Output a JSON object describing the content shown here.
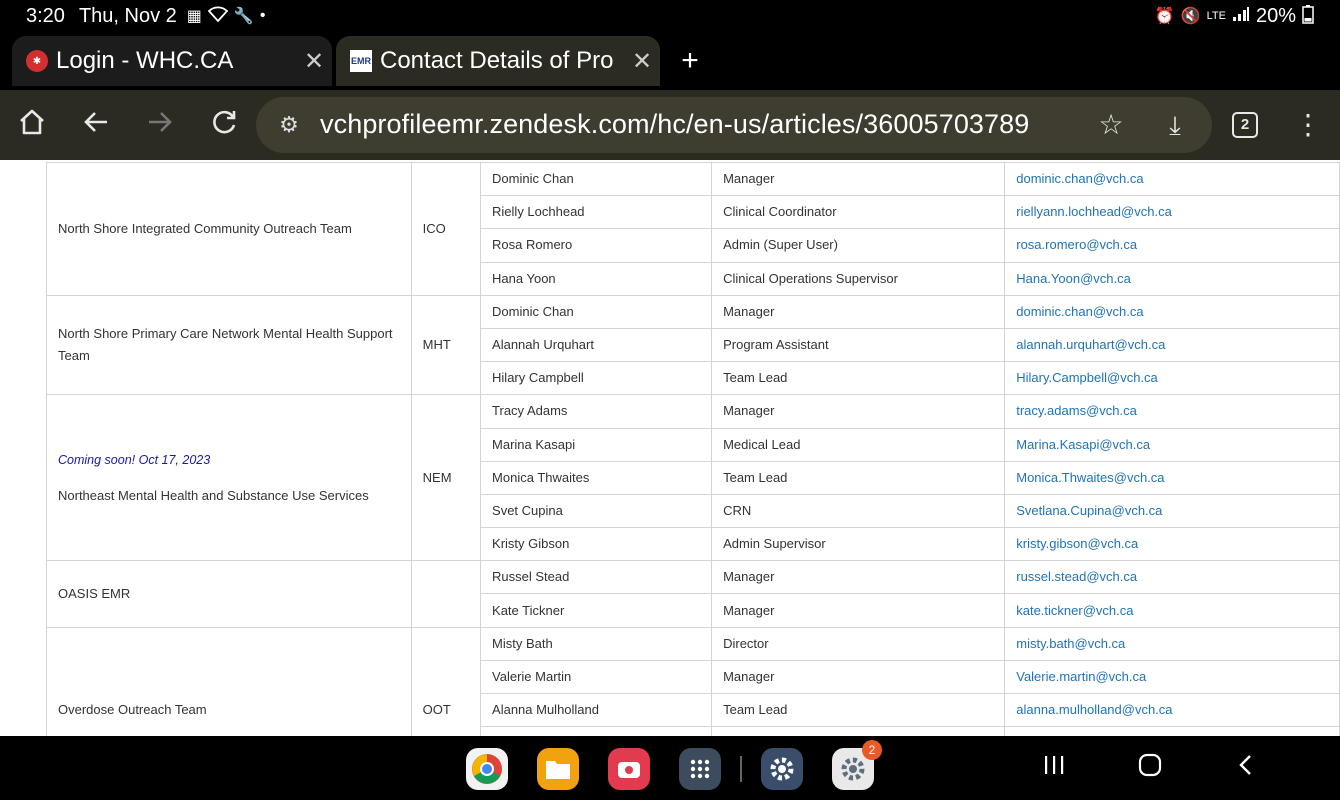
{
  "status_bar": {
    "time": "3:20",
    "date": "Thu, Nov 2",
    "network": "LTE",
    "battery": "20%"
  },
  "tabs": [
    {
      "title": "Login - WHC.CA",
      "favicon": "whc-logo-icon"
    },
    {
      "title": "Contact Details of Pro",
      "favicon": "emr-logo-icon"
    }
  ],
  "toolbar": {
    "url": "vchprofileemr.zendesk.com/hc/en-us/articles/36005703789",
    "tab_count": "2"
  },
  "table": {
    "groups": [
      {
        "team": "North Shore Integrated Community Outreach Team",
        "code": "ICO",
        "coming_soon": "",
        "contacts": [
          {
            "name": "Dominic Chan",
            "role": "Manager",
            "email": "dominic.chan@vch.ca"
          },
          {
            "name": "Rielly Lochhead",
            "role": "Clinical Coordinator",
            "email": "riellyann.lochhead@vch.ca"
          },
          {
            "name": "Rosa Romero",
            "role": "Admin (Super User)",
            "email": "rosa.romero@vch.ca"
          },
          {
            "name": "Hana Yoon",
            "role": "Clinical Operations Supervisor",
            "email": "Hana.Yoon@vch.ca"
          }
        ]
      },
      {
        "team": "North Shore Primary Care Network Mental Health Support Team",
        "code": "MHT",
        "coming_soon": "",
        "contacts": [
          {
            "name": "Dominic Chan",
            "role": "Manager",
            "email": "dominic.chan@vch.ca"
          },
          {
            "name": "Alannah Urquhart",
            "role": "Program Assistant",
            "email": "alannah.urquhart@vch.ca"
          },
          {
            "name": "Hilary Campbell",
            "role": "Team Lead",
            "email": "Hilary.Campbell@vch.ca"
          }
        ]
      },
      {
        "team": "Northeast Mental Health and Substance Use Services",
        "code": "NEM",
        "coming_soon": "Coming soon! Oct 17, 2023",
        "contacts": [
          {
            "name": "Tracy Adams",
            "role": "Manager",
            "email": "tracy.adams@vch.ca"
          },
          {
            "name": "Marina Kasapi",
            "role": "Medical Lead",
            "email": "Marina.Kasapi@vch.ca"
          },
          {
            "name": "Monica Thwaites",
            "role": "Team Lead",
            "email": "Monica.Thwaites@vch.ca"
          },
          {
            "name": "Svet Cupina",
            "role": "CRN",
            "email": "Svetlana.Cupina@vch.ca"
          },
          {
            "name": "Kristy Gibson",
            "role": "Admin Supervisor",
            "email": "kristy.gibson@vch.ca"
          }
        ]
      },
      {
        "team": "OASIS EMR",
        "code": "",
        "coming_soon": "",
        "contacts": [
          {
            "name": "Russel Stead",
            "role": "Manager",
            "email": "russel.stead@vch.ca"
          },
          {
            "name": "Kate Tickner",
            "role": "Manager",
            "email": "kate.tickner@vch.ca"
          }
        ]
      },
      {
        "team": "Overdose Outreach Team",
        "code": "OOT",
        "coming_soon": "",
        "contacts": [
          {
            "name": "Misty Bath",
            "role": "Director",
            "email": "misty.bath@vch.ca"
          },
          {
            "name": "Valerie Martin",
            "role": "Manager",
            "email": "Valerie.martin@vch.ca"
          },
          {
            "name": "Alanna Mulholland",
            "role": "Team Lead",
            "email": "alanna.mulholland@vch.ca"
          },
          {
            "name": "",
            "role": "",
            "email": ""
          },
          {
            "name": "",
            "role": "",
            "email": ""
          }
        ]
      }
    ]
  },
  "dock": {
    "apps": [
      {
        "name": "chrome-icon"
      },
      {
        "name": "files-icon"
      },
      {
        "name": "screen-recorder-icon"
      },
      {
        "name": "app-drawer-icon"
      },
      {
        "name": "settings-icon"
      },
      {
        "name": "google-settings-icon",
        "badge": "2"
      }
    ]
  }
}
